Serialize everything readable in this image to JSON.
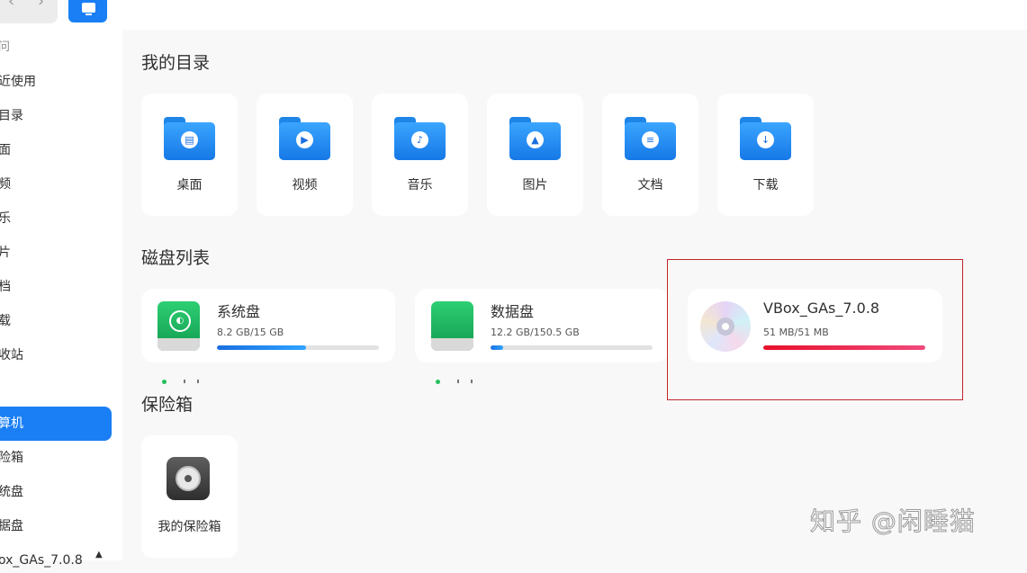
{
  "toolbar": {
    "back_glyph": "‹",
    "forward_glyph": "›",
    "view_icon": "computer-view-icon"
  },
  "sidebar": {
    "items": [
      {
        "label": "问"
      },
      {
        "label": "近使用"
      },
      {
        "label": "目录"
      },
      {
        "label": "面"
      },
      {
        "label": "频"
      },
      {
        "label": "乐"
      },
      {
        "label": "片"
      },
      {
        "label": "档"
      },
      {
        "label": "载"
      },
      {
        "label": "收站"
      }
    ],
    "active": {
      "label": "算机"
    },
    "devices": [
      {
        "label": "险箱"
      },
      {
        "label": "统盘"
      },
      {
        "label": "据盘"
      },
      {
        "label": "ox_GAs_7.0.8"
      }
    ],
    "eject_glyph": "▲"
  },
  "main": {
    "my_dirs": {
      "title": "我的目录",
      "items": [
        {
          "label": "桌面",
          "icon": "desktop-folder-icon",
          "glyph": "▤"
        },
        {
          "label": "视频",
          "icon": "video-folder-icon",
          "glyph": "▶"
        },
        {
          "label": "音乐",
          "icon": "music-folder-icon",
          "glyph": "♪"
        },
        {
          "label": "图片",
          "icon": "picture-folder-icon",
          "glyph": "▲"
        },
        {
          "label": "文档",
          "icon": "document-folder-icon",
          "glyph": "≡"
        },
        {
          "label": "下载",
          "icon": "download-folder-icon",
          "glyph": "↓"
        }
      ]
    },
    "disks": {
      "title": "磁盘列表",
      "items": [
        {
          "name": "系统盘",
          "size": "8.2 GB/15 GB",
          "usage": 0.55,
          "icon": "system-drive-icon"
        },
        {
          "name": "数据盘",
          "size": "12.2 GB/150.5 GB",
          "usage": 0.08,
          "icon": "data-drive-icon"
        },
        {
          "name": "VBox_GAs_7.0.8",
          "size": "51 MB/51 MB",
          "usage": 1.0,
          "icon": "optical-disc-icon"
        }
      ]
    },
    "vault": {
      "title": "保险箱",
      "item_label": "我的保险箱",
      "icon": "vault-icon"
    }
  },
  "watermark": "知乎 @闲睡猫",
  "colors": {
    "accent": "#1a7ff5",
    "disk_bar": "#1a6fe0",
    "disc_bar": "#e8102a",
    "highlight": "#c0262b"
  }
}
